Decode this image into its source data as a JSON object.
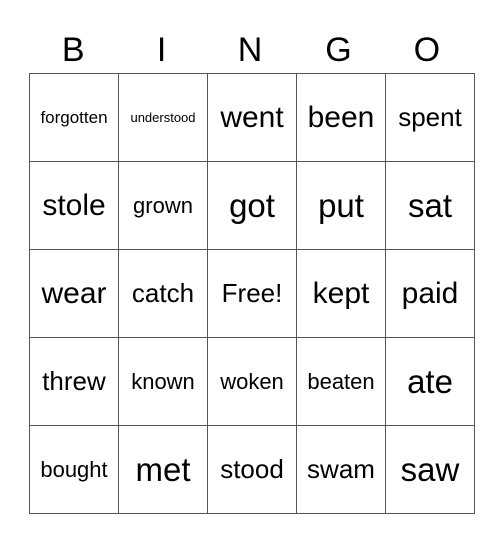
{
  "header": [
    "B",
    "I",
    "N",
    "G",
    "O"
  ],
  "grid": [
    [
      "forgotten",
      "understood",
      "went",
      "been",
      "spent"
    ],
    [
      "stole",
      "grown",
      "got",
      "put",
      "sat"
    ],
    [
      "wear",
      "catch",
      "Free!",
      "kept",
      "paid"
    ],
    [
      "threw",
      "known",
      "woken",
      "beaten",
      "ate"
    ],
    [
      "bought",
      "met",
      "stood",
      "swam",
      "saw"
    ]
  ]
}
